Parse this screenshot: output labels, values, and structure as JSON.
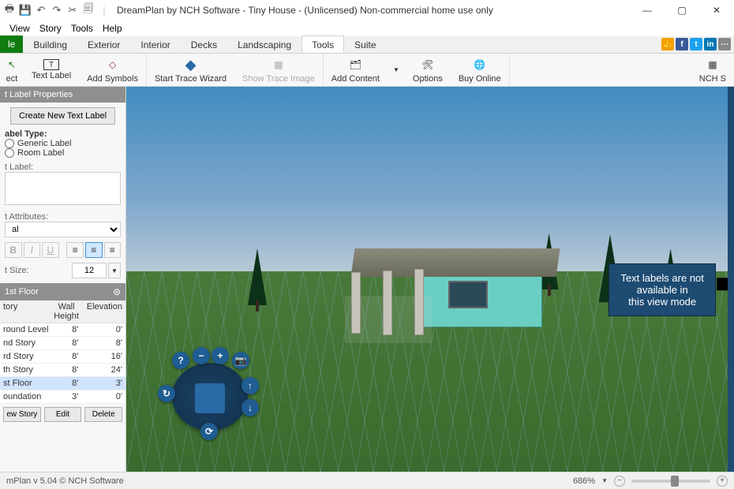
{
  "window": {
    "title": "DreamPlan by NCH Software - Tiny House - (Unlicensed) Non-commercial home use only"
  },
  "menubar": [
    "View",
    "Story",
    "Tools",
    "Help"
  ],
  "tabs": {
    "file": "le",
    "items": [
      "Building",
      "Exterior",
      "Interior",
      "Decks",
      "Landscaping",
      "Tools",
      "Suite"
    ],
    "active": "Tools"
  },
  "ribbon": {
    "select": "ect",
    "text_label": "Text Label",
    "add_symbols": "Add Symbols",
    "start_trace": "Start Trace Wizard",
    "show_trace": "Show Trace Image",
    "add_content": "Add Content",
    "options": "Options",
    "buy_online": "Buy Online",
    "nch_suite": "NCH S"
  },
  "panel": {
    "title": "t Label Properties",
    "create_btn": "Create New Text Label",
    "label_type": "abel Type:",
    "generic": "Generic Label",
    "room": "Room Label",
    "text_label": "t Label:",
    "attributes": "t Attributes:",
    "font": "al",
    "size_label": "t Size:",
    "size_value": "12"
  },
  "story": {
    "header": "1st Floor",
    "cols": {
      "c1": "tory",
      "c2": "Wall Height",
      "c3": "Elevation"
    },
    "rows": [
      {
        "name": "round Level",
        "wh": "8'",
        "el": "0'"
      },
      {
        "name": "nd Story",
        "wh": "8'",
        "el": "8'"
      },
      {
        "name": "rd Story",
        "wh": "8'",
        "el": "16'"
      },
      {
        "name": "th Story",
        "wh": "8'",
        "el": "24'"
      },
      {
        "name": "st Floor",
        "wh": "8'",
        "el": "3'",
        "sel": true
      },
      {
        "name": "oundation",
        "wh": "3'",
        "el": "0'"
      }
    ],
    "btns": {
      "new": "ew Story",
      "edit": "Edit",
      "delete": "Delete"
    }
  },
  "viewport": {
    "tooltip": "Text labels are not\navailable in\nthis view mode"
  },
  "status": {
    "version": "mPlan v 5.04 © NCH Software",
    "zoom": "686%"
  }
}
